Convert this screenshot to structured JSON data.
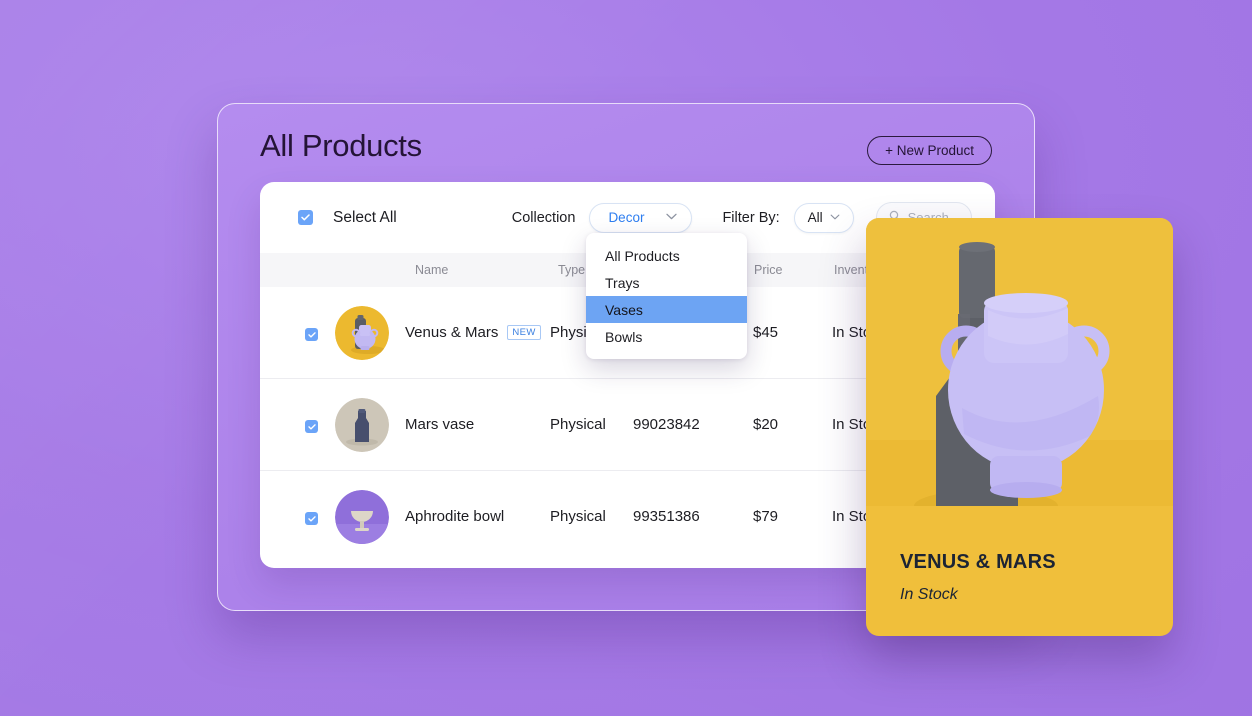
{
  "page": {
    "title": "All Products",
    "new_product_button": "+ New Product"
  },
  "toolbar": {
    "select_all_label": "Select All",
    "collection_label": "Collection",
    "collection_value": "Decor",
    "filter_label": "Filter By:",
    "filter_value": "All",
    "search_placeholder": "Search",
    "chevron": "⌄"
  },
  "dropdown": {
    "items": [
      {
        "label": "All Products",
        "selected": false
      },
      {
        "label": "Trays",
        "selected": false
      },
      {
        "label": "Vases",
        "selected": true
      },
      {
        "label": "Bowls",
        "selected": false
      }
    ]
  },
  "table": {
    "headers": {
      "name": "Name",
      "type": "Type",
      "sku": "",
      "price": "Price",
      "inventory": "Inventory"
    },
    "rows": [
      {
        "name": "Venus & Mars",
        "badge": "NEW",
        "type": "Physical",
        "sku": "",
        "price": "$45",
        "inventory": "In Stock",
        "thumb": "venus-mars-thumb"
      },
      {
        "name": "Mars vase",
        "badge": "",
        "type": "Physical",
        "sku": "99023842",
        "price": "$20",
        "inventory": "In Stock",
        "thumb": "mars-vase-thumb"
      },
      {
        "name": "Aphrodite bowl",
        "badge": "",
        "type": "Physical",
        "sku": "99351386",
        "price": "$79",
        "inventory": "In Stock",
        "thumb": "aphrodite-bowl-thumb"
      }
    ]
  },
  "product_card": {
    "title": "VENUS & MARS",
    "status": "In Stock",
    "background_color": "#f0bf3b",
    "vase_color": "#c2b9f2",
    "bottle_color": "#5d6067"
  },
  "colors": {
    "backdrop": "#a478e6",
    "panel": "#ad83ea",
    "accent_blue": "#2e7ef0",
    "checkbox_blue": "#6ba4f8",
    "highlight_blue": "#6da4f3",
    "card_yellow": "#f0bf3b"
  }
}
